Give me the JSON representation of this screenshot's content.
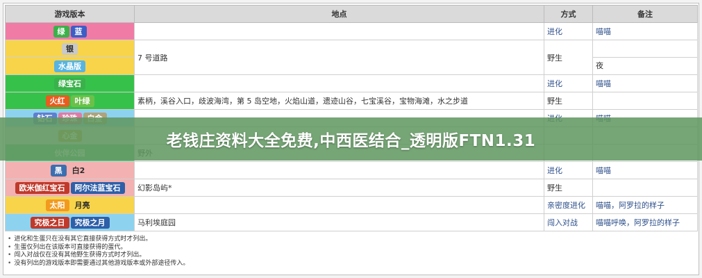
{
  "banner": {
    "title": "老钱庄资料大全免费,中西医结合_透明版FTN1.31",
    "color": "#6a9e68"
  },
  "table": {
    "headers": {
      "version": "游戏版本",
      "location": "地点",
      "method": "方式",
      "note": "备注"
    },
    "rows": [
      {
        "bg": "#f07ca6",
        "badges": [
          {
            "text": "绿",
            "color": "#3ab14a",
            "dark": true
          },
          {
            "text": "蓝",
            "color": "#3b5fc4",
            "dark": true
          }
        ],
        "location": "",
        "method": "进化",
        "method_plain": false,
        "note": "喵喵",
        "note_plain": false
      },
      {
        "bg": "#f7d44a",
        "badges": [
          {
            "text": "银",
            "color": "#c9c9c9",
            "dark": false
          }
        ],
        "location": "7 号道路",
        "method": "野生",
        "method_plain": true,
        "note": "",
        "note_plain": true,
        "split_note": true,
        "note_bottom": "夜",
        "rowspan_loc": 2
      },
      {
        "bg": "#f7d44a",
        "badges": [
          {
            "text": "水晶版",
            "color": "#58b4e0",
            "dark": true
          }
        ],
        "skip_loc": true,
        "skip_method": true,
        "skip_note": true
      },
      {
        "bg": "#36c24a",
        "badges": [
          {
            "text": "绿宝石",
            "color": "#3ab14a",
            "dark": true
          }
        ],
        "location": "",
        "method": "进化",
        "method_plain": false,
        "note": "喵喵",
        "note_plain": false
      },
      {
        "bg": "#36c24a",
        "badges": [
          {
            "text": "火红",
            "color": "#e85c1f",
            "dark": true
          },
          {
            "text": "叶绿",
            "color": "#6cc04a",
            "dark": true
          }
        ],
        "location": "素柄，溪谷入口，歧波海湾，第 5 岛空地，火焰山道，遗迹山谷，七宝溪谷，宝物海滩，水之步道",
        "method": "野生",
        "method_plain": true,
        "note": "",
        "note_plain": true
      },
      {
        "bg": "#8dd3f0",
        "badges": [
          {
            "text": "钻石",
            "color": "#5f7fd0",
            "dark": true
          },
          {
            "text": "珍珠",
            "color": "#e27aa6",
            "dark": true
          },
          {
            "text": "白金",
            "color": "#b0a27a",
            "dark": true
          }
        ],
        "location": "",
        "method": "进化",
        "method_plain": false,
        "note": "喵喵",
        "note_plain": false
      },
      {
        "bg": "#d9d9d9",
        "badges": [
          {
            "text": "心金",
            "color": "#c9a94a",
            "dark": true
          }
        ],
        "location": "",
        "method": "",
        "method_plain": true,
        "note": "",
        "note_plain": true
      },
      {
        "bg": "#6ecf8a",
        "badges": [
          {
            "text": "伙伴公园",
            "color": "#6ecf8a",
            "dark": true
          }
        ],
        "location": "野外",
        "method": "",
        "method_plain": true,
        "note": "",
        "note_plain": true
      },
      {
        "bg": "#f3b1b1",
        "badges": [
          {
            "text": "黑",
            "color": "#3b6fb0",
            "dark": true
          },
          {
            "text": "白2",
            "color": "#f3b1b1",
            "dark": false
          }
        ],
        "location": "",
        "method": "进化",
        "method_plain": false,
        "note": "喵喵",
        "note_plain": false
      },
      {
        "bg": "#f3b1b1",
        "badges": [
          {
            "text": "欧米伽红宝石",
            "color": "#c0392b",
            "dark": true
          },
          {
            "text": "阿尔法蓝宝石",
            "color": "#2e5fa8",
            "dark": true
          }
        ],
        "location": "幻影岛屿*",
        "method": "野生",
        "method_plain": true,
        "note": "",
        "note_plain": true
      },
      {
        "bg": "#f7d44a",
        "badges": [
          {
            "text": "太阳",
            "color": "#f29a1e",
            "dark": true
          },
          {
            "text": "月亮",
            "color": "#f7d44a",
            "dark": false
          }
        ],
        "location": "",
        "method": "亲密度进化",
        "method_plain": false,
        "note": "喵喵，阿罗拉的样子",
        "note_plain": false
      },
      {
        "bg": "#8dd3f0",
        "badges": [
          {
            "text": "究极之日",
            "color": "#c0392b",
            "dark": true
          },
          {
            "text": "究极之月",
            "color": "#2e5fa8",
            "dark": true
          }
        ],
        "location": "马利埃庭园",
        "method": "闯入对战",
        "method_plain": false,
        "note": "喵喵呼唤，阿罗拉的样子",
        "note_plain": false
      }
    ]
  },
  "footnotes": [
    "进化和生蛋只在没有其它直接获得方式时才列出。",
    "生蛋仅列出在该版本可直接获得的蛋代。",
    "闯入对战仅在没有其他野生获得方式时才列出。",
    "没有列出的游戏版本即需要通过其他游戏版本或外部途径传入。"
  ]
}
